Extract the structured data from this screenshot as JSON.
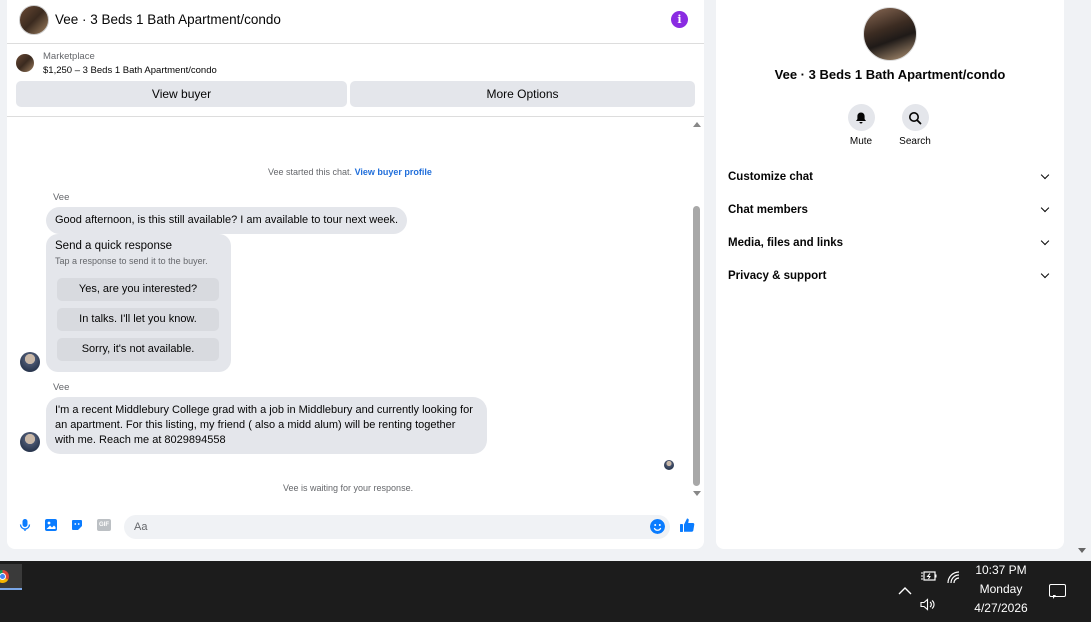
{
  "header": {
    "title": "Vee · 3 Beds 1 Bath Apartment/condo",
    "info_icon": "info-circle-icon"
  },
  "marketplace": {
    "label": "Marketplace",
    "listing": "$1,250 – 3 Beds 1 Bath Apartment/condo",
    "view_buyer": "View buyer",
    "more_options": "More Options"
  },
  "messages": {
    "started_text": "Vee started this chat.",
    "view_buyer_profile": "View buyer profile",
    "sender_name": "Vee",
    "msg1": "Good afternoon, is this still available? I am available to tour next week.",
    "quick_response": {
      "title": "Send a quick response",
      "subtitle": "Tap a response to send it to the buyer.",
      "options": [
        "Yes, are you interested?",
        "In talks. I'll let you know.",
        "Sorry, it's not available."
      ]
    },
    "msg2": "I'm a recent Middlebury College grad with a job in Middlebury and currently looking for an apartment. For this listing, my friend ( also a midd alum) will be renting together with me. Reach me at 8029894558",
    "waiting_text": "Vee is waiting for your response."
  },
  "composer": {
    "placeholder": "Aa",
    "icons": [
      "microphone-icon",
      "image-icon",
      "sticker-icon",
      "gif-icon",
      "emoji-icon",
      "thumbs-up-icon"
    ],
    "gif_label": "GIF"
  },
  "right_panel": {
    "title": "Vee · 3 Beds 1 Bath Apartment/condo",
    "actions": [
      {
        "label": "Mute",
        "icon": "bell-icon"
      },
      {
        "label": "Search",
        "icon": "search-icon"
      }
    ],
    "sections": [
      "Customize chat",
      "Chat members",
      "Media, files and links",
      "Privacy & support"
    ]
  },
  "taskbar": {
    "time": "10:37 PM",
    "day": "Monday",
    "date": "4/27/2026"
  },
  "colors": {
    "accent": "#0a7cff",
    "info": "#8a2be2",
    "bubble": "#e4e6eb",
    "link": "#216fdb"
  }
}
